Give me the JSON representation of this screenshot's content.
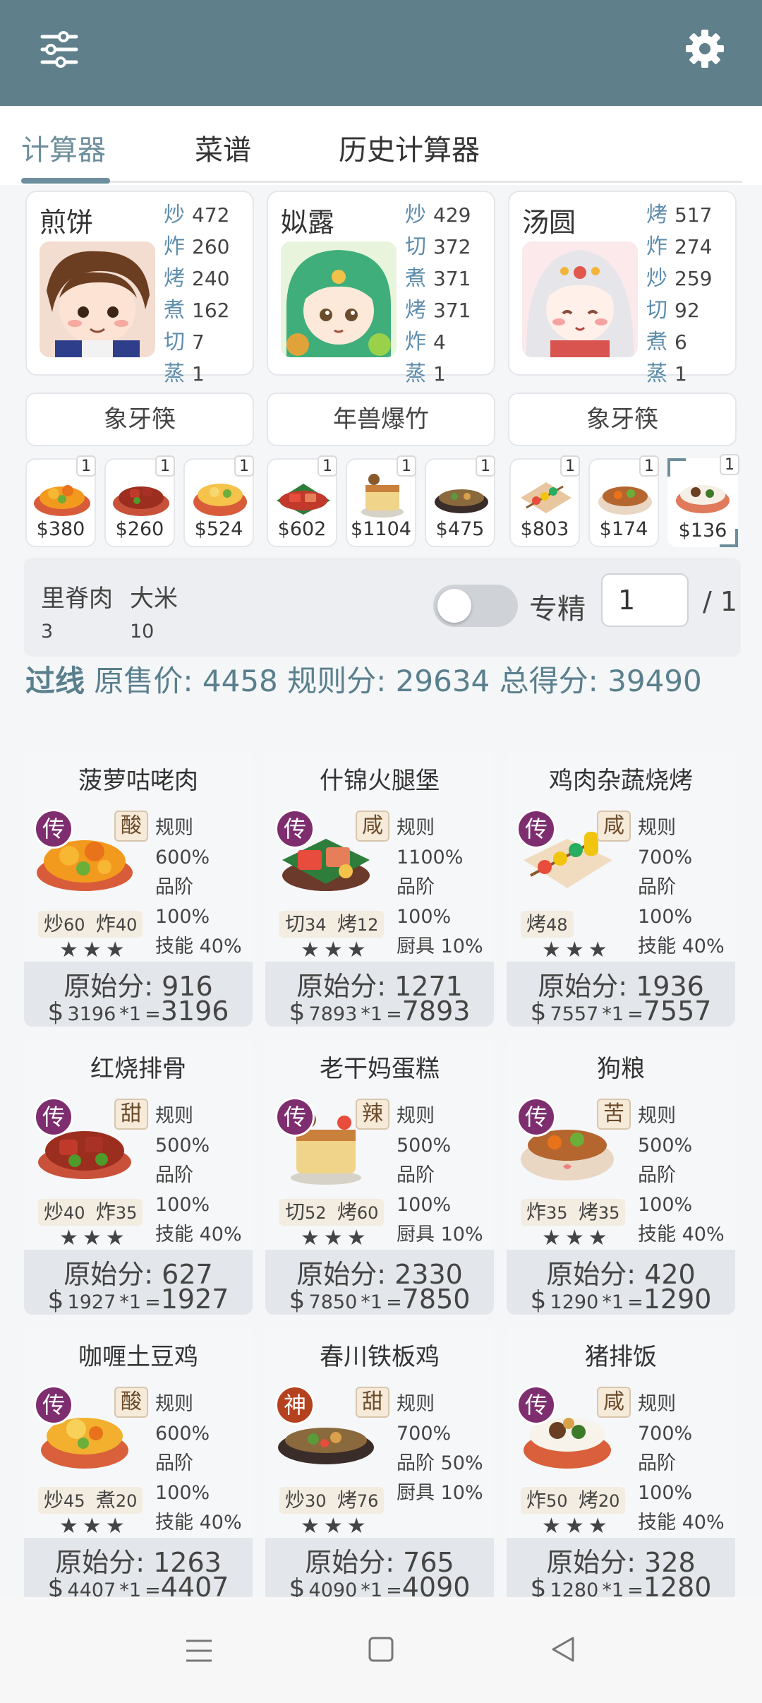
{
  "tabs": [
    {
      "label": "计算器",
      "active": true
    },
    {
      "label": "菜谱",
      "active": false
    },
    {
      "label": "历史计算器",
      "active": false
    }
  ],
  "chefs": [
    {
      "name": "煎饼",
      "skills": [
        {
          "k": "炒",
          "v": "472"
        },
        {
          "k": "炸",
          "v": "260"
        },
        {
          "k": "烤",
          "v": "240"
        },
        {
          "k": "煮",
          "v": "162"
        },
        {
          "k": "切",
          "v": "7"
        },
        {
          "k": "蒸",
          "v": "1"
        }
      ],
      "equipment": "象牙筷"
    },
    {
      "name": "姒露",
      "skills": [
        {
          "k": "炒",
          "v": "429"
        },
        {
          "k": "切",
          "v": "372"
        },
        {
          "k": "煮",
          "v": "371"
        },
        {
          "k": "烤",
          "v": "371"
        },
        {
          "k": "炸",
          "v": "4"
        },
        {
          "k": "蒸",
          "v": "1"
        }
      ],
      "equipment": "年兽爆竹"
    },
    {
      "name": "汤圆",
      "skills": [
        {
          "k": "烤",
          "v": "517"
        },
        {
          "k": "炸",
          "v": "274"
        },
        {
          "k": "炒",
          "v": "259"
        },
        {
          "k": "切",
          "v": "92"
        },
        {
          "k": "煮",
          "v": "6"
        },
        {
          "k": "蒸",
          "v": "1"
        }
      ],
      "equipment": "象牙筷"
    }
  ],
  "dish_thumbs": [
    {
      "price": "$380",
      "count": "1"
    },
    {
      "price": "$260",
      "count": "1"
    },
    {
      "price": "$524",
      "count": "1"
    },
    {
      "price": "$602",
      "count": "1"
    },
    {
      "price": "$1104",
      "count": "1"
    },
    {
      "price": "$475",
      "count": "1"
    },
    {
      "price": "$803",
      "count": "1"
    },
    {
      "price": "$174",
      "count": "1"
    },
    {
      "price": "$136",
      "count": "1",
      "selected": true
    }
  ],
  "ingredients": [
    {
      "name": "里脊肉",
      "qty": "3"
    },
    {
      "name": "大米",
      "qty": "10"
    }
  ],
  "specialize": {
    "label": "专精",
    "enabled": false,
    "value": "1",
    "total": "/ 1"
  },
  "summary": {
    "pass": "过线",
    "orig_label": "原售价:",
    "orig_value": "4458",
    "rule_label": "规则分:",
    "rule_value": "29634",
    "total_label": "总得分:",
    "total_value": "39490"
  },
  "recipes": [
    {
      "name": "菠萝咕咾肉",
      "rarity": "传",
      "flavor": "酸",
      "rule": "规则 600%",
      "grade": "品阶 100%",
      "third": "技能 40%",
      "reqs": [
        {
          "k": "炒",
          "v": "60"
        },
        {
          "k": "炸",
          "v": "40"
        }
      ],
      "stars": "★★★",
      "orig": "原始分: 916",
      "price": "3196",
      "mult": "*1",
      "total": "3196",
      "img": "orange"
    },
    {
      "name": "什锦火腿堡",
      "rarity": "传",
      "flavor": "咸",
      "rule": "规则 1100%",
      "grade": "品阶 100%",
      "third": "厨具 10%",
      "reqs": [
        {
          "k": "切",
          "v": "34"
        },
        {
          "k": "烤",
          "v": "12"
        }
      ],
      "stars": "★★★",
      "orig": "原始分: 1271",
      "price": "7893",
      "mult": "*1",
      "total": "7893",
      "img": "ham"
    },
    {
      "name": "鸡肉杂蔬烧烤",
      "rarity": "传",
      "flavor": "咸",
      "rule": "规则 700%",
      "grade": "品阶 100%",
      "third": "技能 40%",
      "reqs": [
        {
          "k": "烤",
          "v": "48"
        }
      ],
      "stars": "★★★",
      "orig": "原始分: 1936",
      "price": "7557",
      "mult": "*1",
      "total": "7557",
      "img": "skewer"
    },
    {
      "name": "红烧排骨",
      "rarity": "传",
      "flavor": "甜",
      "rule": "规则 500%",
      "grade": "品阶 100%",
      "third": "技能 40%",
      "reqs": [
        {
          "k": "炒",
          "v": "40"
        },
        {
          "k": "炸",
          "v": "35"
        }
      ],
      "stars": "★★★",
      "orig": "原始分: 627",
      "price": "1927",
      "mult": "*1",
      "total": "1927",
      "img": "ribs"
    },
    {
      "name": "老干妈蛋糕",
      "rarity": "传",
      "flavor": "辣",
      "rule": "规则 500%",
      "grade": "品阶 100%",
      "third": "厨具 10%",
      "reqs": [
        {
          "k": "切",
          "v": "52"
        },
        {
          "k": "烤",
          "v": "60"
        }
      ],
      "stars": "★★★",
      "orig": "原始分: 2330",
      "price": "7850",
      "mult": "*1",
      "total": "7850",
      "img": "cake"
    },
    {
      "name": "狗粮",
      "rarity": "传",
      "flavor": "苦",
      "rule": "规则 500%",
      "grade": "品阶 100%",
      "third": "技能 40%",
      "reqs": [
        {
          "k": "炸",
          "v": "35"
        },
        {
          "k": "烤",
          "v": "35"
        }
      ],
      "stars": "★★★",
      "orig": "原始分: 420",
      "price": "1290",
      "mult": "*1",
      "total": "1290",
      "img": "bowl"
    },
    {
      "name": "咖喱土豆鸡",
      "rarity": "传",
      "flavor": "酸",
      "rule": "规则 600%",
      "grade": "品阶 100%",
      "third": "技能 40%",
      "reqs": [
        {
          "k": "炒",
          "v": "45"
        },
        {
          "k": "煮",
          "v": "20"
        }
      ],
      "stars": "★★★",
      "orig": "原始分: 1263",
      "price": "4407",
      "mult": "*1",
      "total": "4407",
      "img": "curry"
    },
    {
      "name": "春川铁板鸡",
      "rarity": "神",
      "flavor": "甜",
      "rule": "规则 700%",
      "grade": "品阶 50%",
      "third": "厨具 10%",
      "reqs": [
        {
          "k": "炒",
          "v": "30"
        },
        {
          "k": "烤",
          "v": "76"
        }
      ],
      "stars": "★★★",
      "orig": "原始分: 765",
      "price": "4090",
      "mult": "*1",
      "total": "4090",
      "img": "pan"
    },
    {
      "name": "猪排饭",
      "rarity": "传",
      "flavor": "咸",
      "rule": "规则 700%",
      "grade": "品阶 100%",
      "third": "技能 40%",
      "reqs": [
        {
          "k": "炸",
          "v": "50"
        },
        {
          "k": "烤",
          "v": "20"
        }
      ],
      "stars": "★★★",
      "orig": "原始分: 328",
      "price": "1280",
      "mult": "*1",
      "total": "1280",
      "img": "rice"
    }
  ],
  "colors": {
    "appbar": "#5f7f8b",
    "accent": "#6d8e9c",
    "skill_key": "#5e8dad",
    "rarity_chuan": "#7e2e6f",
    "rarity_shen": "#b5421e"
  },
  "icons": {
    "menu": "sliders-menu-icon",
    "settings": "gear-icon",
    "nav_menu": "hamburger-icon",
    "nav_home": "square-home-icon",
    "nav_back": "triangle-back-icon"
  }
}
